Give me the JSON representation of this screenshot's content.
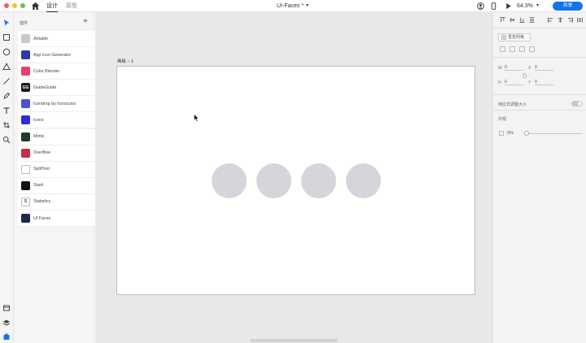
{
  "header": {
    "tabs": [
      {
        "label": "设计",
        "active": true
      },
      {
        "label": "原型",
        "active": false
      }
    ],
    "document_title": "UI-Faces *",
    "zoom": "64.3%",
    "share_label": "共享"
  },
  "plugins_panel": {
    "title": "插件",
    "items": [
      {
        "label": "Airtable",
        "icon": "airtable-icon",
        "color": "#c9c9c9",
        "has_submenu": false
      },
      {
        "label": "App Icon Generator",
        "icon": "app-icon-generator-icon",
        "color": "#2d3aa8",
        "has_submenu": false
      },
      {
        "label": "Color Blender",
        "icon": "color-blender-icon",
        "color": "#e83e6f",
        "has_submenu": false
      },
      {
        "label": "GuideGuide",
        "icon": "guideguide-icon",
        "color": "#1b1b1b",
        "glyph": "GG",
        "has_submenu": true
      },
      {
        "label": "Icondrop by Iconscout",
        "icon": "icondrop-icon",
        "color": "#4a53d8",
        "has_submenu": false
      },
      {
        "label": "Icons",
        "icon": "icons-icon",
        "color": "#2a2fd6",
        "has_submenu": false
      },
      {
        "label": "Mimic",
        "icon": "mimic-icon",
        "color": "#1f3b2a",
        "has_submenu": false
      },
      {
        "label": "Overflow",
        "icon": "overflow-icon",
        "color": "#c82a4a",
        "has_submenu": false
      },
      {
        "label": "SplitText",
        "icon": "splittext-icon",
        "color": "#ffffff",
        "has_submenu": true
      },
      {
        "label": "Stark",
        "icon": "stark-icon",
        "color": "#111111",
        "has_submenu": true
      },
      {
        "label": "Statistics",
        "icon": "statistics-icon",
        "color": "#ffffff",
        "glyph": "S",
        "has_submenu": false
      },
      {
        "label": "UI Faces",
        "icon": "ui-faces-icon",
        "color": "#1e2a4a",
        "has_submenu": false
      }
    ]
  },
  "canvas": {
    "artboard_label": "画板 – 1",
    "placeholder_circles": 4,
    "circle_color": "#d4d6dc"
  },
  "properties": {
    "repeat_grid_label": "重复网格",
    "fields": {
      "w_label": "W",
      "w_value": "0",
      "x_label": "X",
      "x_value": "0",
      "h_label": "H",
      "h_value": "0",
      "y_label": "Y",
      "y_value": "0"
    },
    "responsive_label": "响应式调整大小",
    "appearance_label": "外观",
    "opacity_value": "0%"
  },
  "colors": {
    "accent": "#1473e6",
    "canvas_bg": "#e8e8e8"
  }
}
